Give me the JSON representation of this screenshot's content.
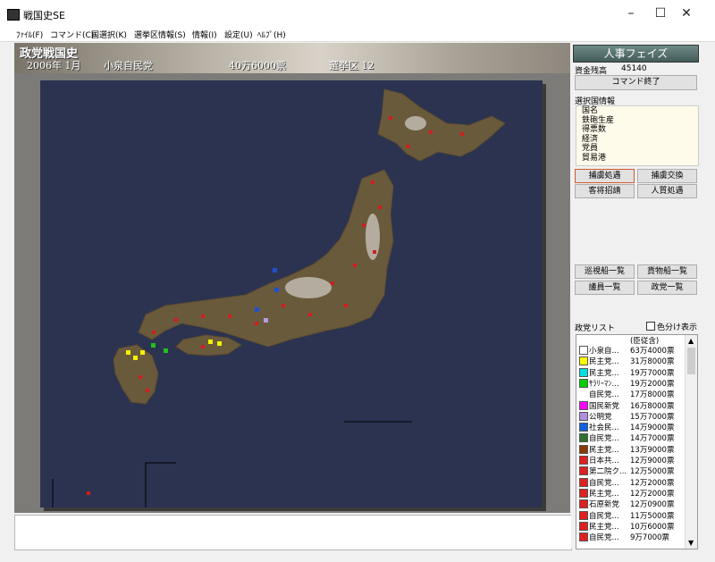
{
  "window": {
    "title": "戦国史SE",
    "minimize": "–",
    "maximize": "☐",
    "close": "✕"
  },
  "menu": [
    "ﾌｧｲﾙ(F)",
    "コマンド(C)",
    "国選択(K)",
    "選挙区情報(S)",
    "情報(I)",
    "設定(U)",
    "ﾍﾙﾌﾟ(H)"
  ],
  "header": {
    "game_title": "政党戦国史",
    "date": "2006年  1月",
    "party": "小泉自民党",
    "votes": "40万6000票",
    "district": "選挙区  12"
  },
  "panel": {
    "phase": "人事フェイズ",
    "funds_label": "資金残高",
    "funds_value": "45140",
    "end_command": "コマンド終了",
    "info_title": "選択国情報",
    "info_items": [
      "国名",
      "鉄砲生産",
      "得票数",
      "経済",
      "党員",
      "貿易港"
    ],
    "buttons": {
      "capture": "捕虜処遇",
      "exchange": "捕虜交換",
      "recruit": "客将招請",
      "hostage": "人質処遇",
      "patrol_list": "巡視船一覧",
      "cargo_list": "貨物船一覧",
      "member_list": "議員一覧",
      "party_list": "政党一覧"
    },
    "party_list_label": "政党リスト",
    "color_toggle": "色分け表示",
    "list_header": "(臣従含)",
    "parties": [
      {
        "name": "小泉自...",
        "votes": "63万4000票",
        "color": "#ffffff"
      },
      {
        "name": "民主党...",
        "votes": "31万8000票",
        "color": "#ffff00"
      },
      {
        "name": "民主党...",
        "votes": "19万7000票",
        "color": "#00e0e0"
      },
      {
        "name": "ｻﾗﾘｰﾏﾝ...",
        "votes": "19万2000票",
        "color": "#00d000"
      },
      {
        "name": "自民党...",
        "votes": "17万8000票",
        "color": ""
      },
      {
        "name": "国民新党",
        "votes": "16万8000票",
        "color": "#ff00ff"
      },
      {
        "name": "公明党",
        "votes": "15万7000票",
        "color": "#b090e0"
      },
      {
        "name": "社会民...",
        "votes": "14万9000票",
        "color": "#1060e0"
      },
      {
        "name": "自民党...",
        "votes": "14万7000票",
        "color": "#307030"
      },
      {
        "name": "民主党...",
        "votes": "13万9000票",
        "color": "#8a3a00"
      },
      {
        "name": "日本共...",
        "votes": "12万9000票",
        "color": "#e02020"
      },
      {
        "name": "第二院ク...",
        "votes": "12万5000票",
        "color": "#e02020"
      },
      {
        "name": "自民党...",
        "votes": "12万2000票",
        "color": "#e02020"
      },
      {
        "name": "民主党...",
        "votes": "12万2000票",
        "color": "#e02020"
      },
      {
        "name": "石原新党",
        "votes": "12万0900票",
        "color": "#e02020"
      },
      {
        "name": "自民党...",
        "votes": "11万5000票",
        "color": "#e02020"
      },
      {
        "name": "民主党...",
        "votes": "10万6000票",
        "color": "#e02020"
      },
      {
        "name": "自民党...",
        "votes": "9万7000票",
        "color": "#e02020"
      }
    ]
  }
}
